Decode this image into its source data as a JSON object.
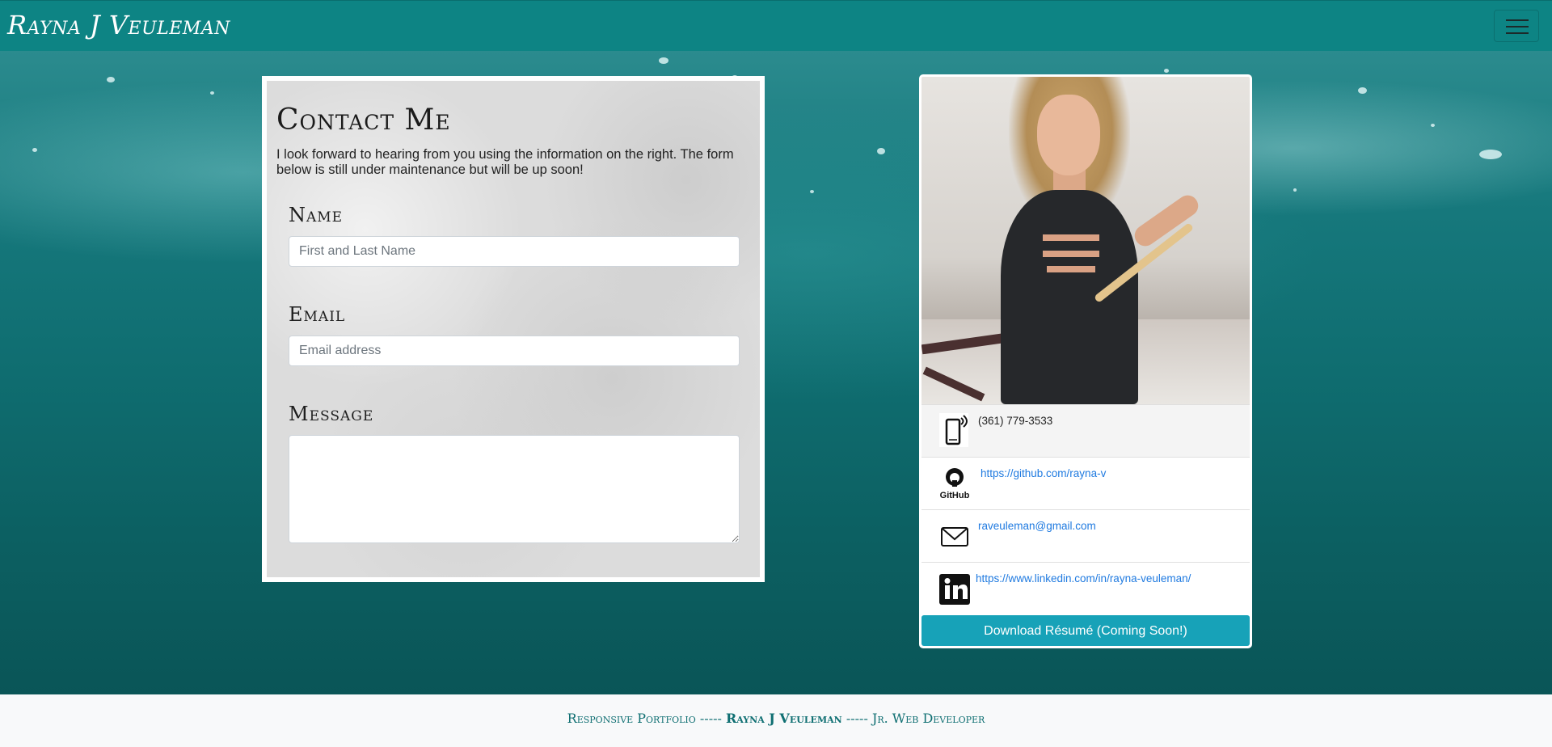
{
  "nav": {
    "brand": "Rayna J Veuleman",
    "toggle_icon": "hamburger-icon"
  },
  "contact": {
    "title": "Contact Me",
    "intro": "I look forward to hearing from you using the information on the right. The form below is still under maintenance but will be up soon!",
    "name_label": "Name",
    "name_placeholder": "First and Last Name",
    "email_label": "Email",
    "email_placeholder": "Email address",
    "message_label": "Message"
  },
  "profile": {
    "phone": "(361) 779-3533",
    "github": "https://github.com/rayna-v",
    "email": "raveuleman@gmail.com",
    "linkedin": "https://www.linkedin.com/in/rayna-veuleman/",
    "github_logo_text": "GitHub",
    "resume_button": "Download Résumé (Coming Soon!)",
    "icons": [
      "phone-icon",
      "github-icon",
      "mail-icon",
      "linkedin-icon"
    ]
  },
  "footer": {
    "left": "Responsive Portfolio",
    "sep": "-----",
    "name": "Rayna J Veuleman",
    "right": "Jr. Web Developer"
  },
  "colors": {
    "navbar": "#0d8484",
    "button": "#17a2b8",
    "link": "#1f7ae0",
    "footer_text": "#0f6f72"
  }
}
